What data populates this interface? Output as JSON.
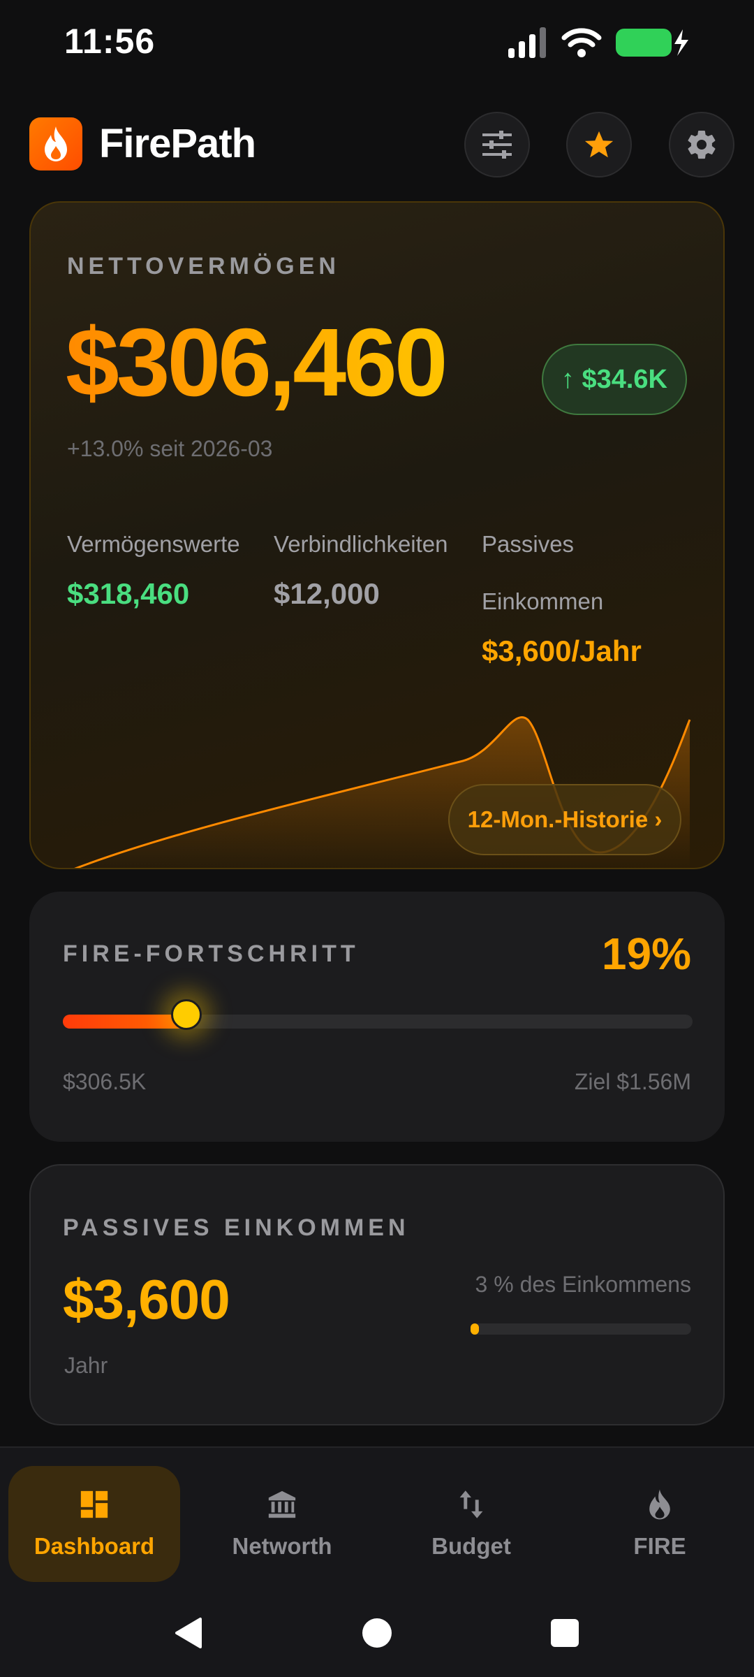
{
  "status_bar": {
    "time": "11:56"
  },
  "app": {
    "title": "FirePath"
  },
  "networth": {
    "label": "NETTOVERMÖGEN",
    "value": "$306,460",
    "change_badge": "↑ $34.6K",
    "growth_text": "+13.0% seit 2026-03",
    "assets_label": "Vermögenswerte",
    "assets_value": "$318,460",
    "liabilities_label": "Verbindlichkeiten",
    "liabilities_value": "$12,000",
    "passive_label_line1": "Passives",
    "passive_label_line2": "Einkommen",
    "passive_value": "$3,600/Jahr",
    "history_button": "12-Mon.-Historie ›"
  },
  "fire_progress": {
    "label": "FIRE-FORTSCHRITT",
    "percent_text": "19%",
    "progress_fraction": 0.196,
    "current_text": "$306.5K",
    "goal_text": "Ziel $1.56M"
  },
  "passive_income": {
    "label": "PASSIVES EINKOMMEN",
    "value": "$3,600",
    "unit": "Jahr",
    "share_text": "3 % des Einkommens",
    "share_fraction": 0.03
  },
  "bottom_nav": {
    "items": [
      {
        "label": "Dashboard",
        "icon": "dashboard-icon",
        "active": true
      },
      {
        "label": "Networth",
        "icon": "bank-icon",
        "active": false
      },
      {
        "label": "Budget",
        "icon": "transfer-arrows-icon",
        "active": false
      },
      {
        "label": "FIRE",
        "icon": "flame-icon",
        "active": false
      }
    ]
  },
  "colors": {
    "accent": "#ffa500",
    "positive": "#4ade80",
    "background": "#0f0f10",
    "card": "#1c1c1e"
  }
}
